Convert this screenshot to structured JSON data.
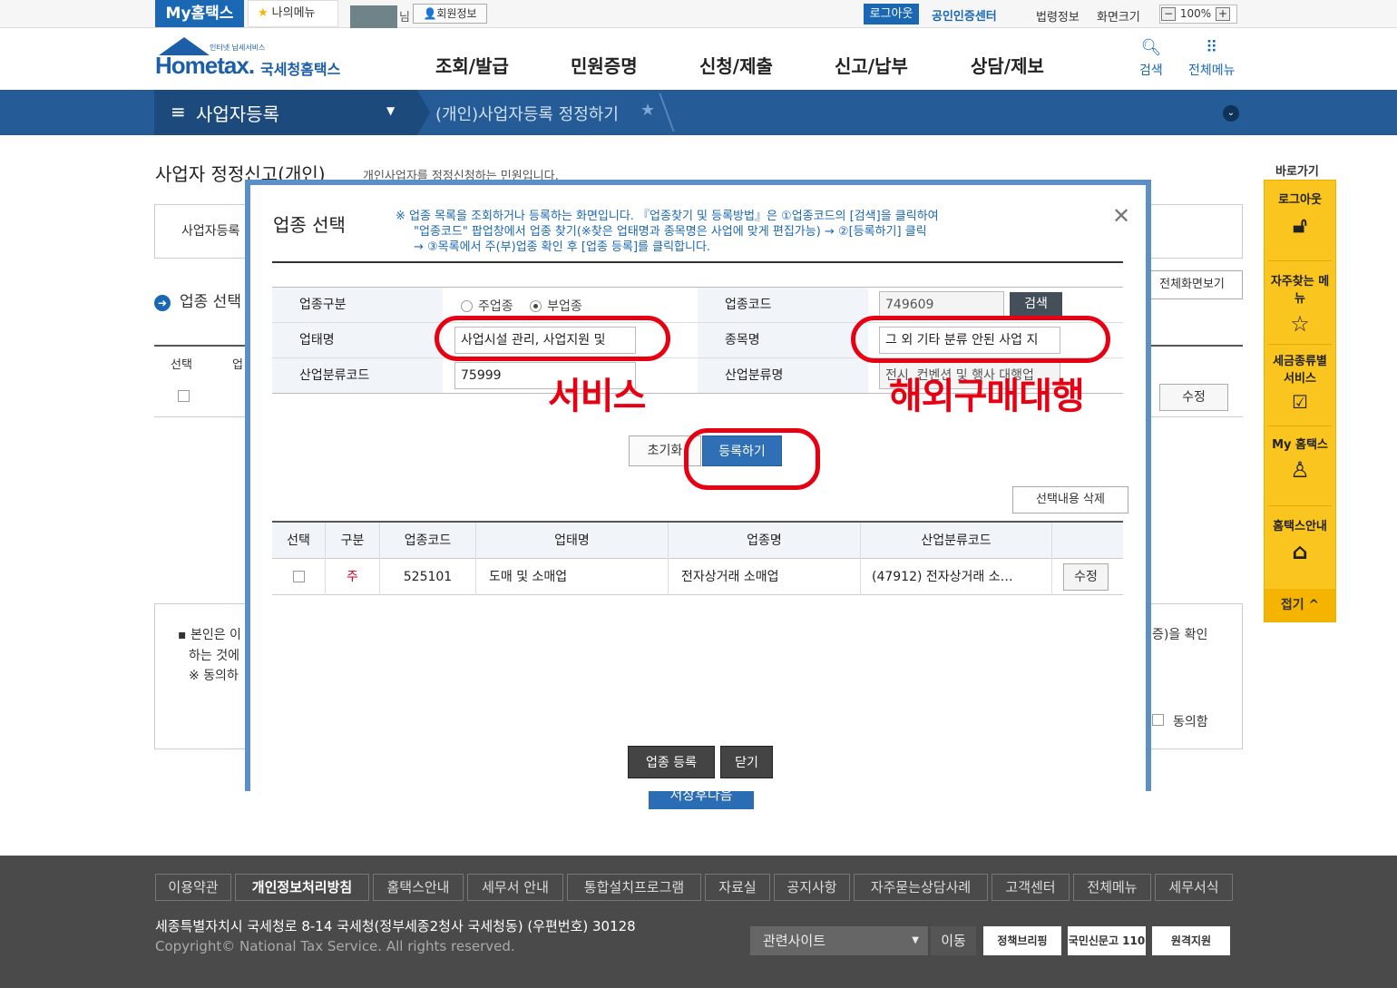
{
  "topbar": {
    "my_hometax": "My홈택스",
    "my_menu": "나의메뉴",
    "user_suffix": "님",
    "member_info": "회원정보",
    "logout": "로그아웃",
    "cert_center": "공인인증센터",
    "law_info": "법령정보",
    "screen_size": "화면크기",
    "zoom_minus": "−",
    "zoom_value": "100%",
    "zoom_plus": "+"
  },
  "header": {
    "logo_main": "Hometax.",
    "logo_sub": "국세청홈택스",
    "logo_tiny": "인터넷 납세서비스",
    "nav": [
      "조회/발급",
      "민원증명",
      "신청/제출",
      "신고/납부",
      "상담/제보"
    ],
    "search_label": "검색",
    "all_menu_label": "전체메뉴"
  },
  "breadcrumb": {
    "section": "사업자등록",
    "current": "(개인)사업자등록 정정하기"
  },
  "background_page": {
    "title": "사업자 정정신고(개인)",
    "description": "개인사업자를 정정신청하는 민원입니다.",
    "box_label": "사업자등록",
    "section_title": "업종 선택",
    "full_view": "전체화면보기",
    "table_headers": [
      "선택",
      "업"
    ],
    "edit": "수정",
    "agree_text1": "본인은 이",
    "agree_text2": "하는 것에",
    "agree_text3": "※  동의하",
    "agree_right": "증)을 확인",
    "agree_label": "동의함",
    "next_button": "저장후다음"
  },
  "quick_panel": {
    "title": "바로가기",
    "items": [
      "로그아웃",
      "자주찾는 메뉴",
      "세금종류별 서비스",
      "My 홈택스",
      "홈택스안내"
    ],
    "fold": "접기 ^"
  },
  "modal": {
    "title": "업종 선택",
    "note_line1": "※ 업종 목록을 조회하거나 등록하는 화면입니다. 『업종찾기 및 등록방법』은 ①업종코드의 [검색]을 클릭하여",
    "note_line2": "\"업종코드\" 팝업창에서 업종 찾기(※찾은 업태명과 종목명은 사업에 맞게 편집가능) → ②[등록하기] 클릭",
    "note_line3": "→ ③목록에서 주(부)업종 확인 후 [업종 등록]를 클릭합니다.",
    "form": {
      "type_label": "업종구분",
      "radio_main": "주업종",
      "radio_sub": "부업종",
      "code_label": "업종코드",
      "code_value": "749609",
      "search_button": "검색",
      "biz_type_label": "업태명",
      "biz_type_value": "사업시설 관리, 사업지원 및",
      "item_label": "종목명",
      "item_value": "그 외 기타 분류 안된 사업 지",
      "ind_code_label": "산업분류코드",
      "ind_code_value": "75999",
      "ind_name_label": "산업분류명",
      "ind_name_value": "전시, 컨벤션 및 행사 대행업"
    },
    "annotation_left": "서비스",
    "annotation_right": "해외구매대행",
    "reset_button": "초기화",
    "register_button": "등록하기",
    "delete_selected": "선택내용 삭제",
    "list_headers": [
      "선택",
      "구분",
      "업종코드",
      "업태명",
      "업종명",
      "산업분류코드"
    ],
    "list_rows": [
      {
        "kind": "주",
        "code": "525101",
        "biz_type": "도매 및 소매업",
        "item": "전자상거래 소매업",
        "ind_code": "(47912) 전자상거래 소…",
        "edit": "수정"
      }
    ],
    "register_industry_button": "업종 등록",
    "close_button": "닫기"
  },
  "footer": {
    "links": [
      "이용약관",
      "개인정보처리방침",
      "홈택스안내",
      "세무서 안내",
      "통합설치프로그램",
      "자료실",
      "공지사항",
      "자주묻는상담사례",
      "고객센터",
      "전체메뉴",
      "세무서식"
    ],
    "address": "세종특별자치시 국세청로 8-14 국세청(정부세종2청사 국세청동) (우편번호) 30128",
    "copyright": "Copyright© National Tax Service. All rights reserved.",
    "related_sites": "관련사이트",
    "go": "이동",
    "badges": [
      "정책브리핑",
      "국민신문고 110",
      "원격지원"
    ]
  },
  "colors": {
    "brand_blue": "#1a67b3",
    "crumb_bar": "#255b96",
    "annotation_red": "#e60012",
    "quick_yellow": "#f9c51e"
  }
}
